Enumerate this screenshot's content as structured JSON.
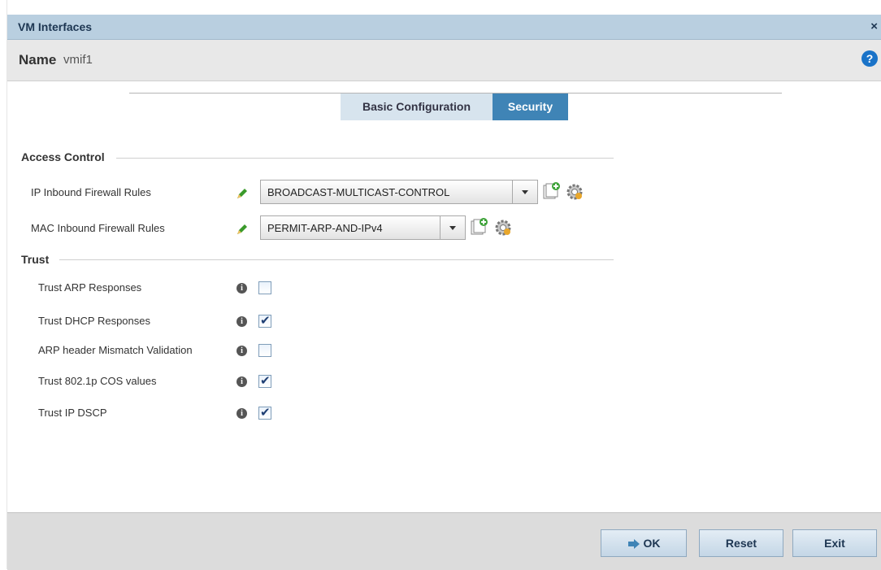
{
  "window": {
    "title": "VM Interfaces",
    "close_glyph": "×"
  },
  "name_bar": {
    "label": "Name",
    "value": "vmif1",
    "help_glyph": "?"
  },
  "tabs": [
    {
      "label": "Basic Configuration",
      "active": false
    },
    {
      "label": "Security",
      "active": true
    }
  ],
  "access_control": {
    "heading": "Access Control",
    "rows": [
      {
        "label": "IP Inbound Firewall Rules",
        "value": "BROADCAST-MULTICAST-CONTROL"
      },
      {
        "label": "MAC Inbound Firewall Rules",
        "value": "PERMIT-ARP-AND-IPv4"
      }
    ]
  },
  "trust": {
    "heading": "Trust",
    "items": [
      {
        "label": "Trust ARP Responses",
        "checked": false
      },
      {
        "label": "Trust DHCP Responses",
        "checked": true
      },
      {
        "label": "ARP header Mismatch Validation",
        "checked": false
      },
      {
        "label": "Trust 802.1p COS values",
        "checked": true
      },
      {
        "label": "Trust IP DSCP",
        "checked": true
      }
    ]
  },
  "footer": {
    "ok_label": "OK",
    "reset_label": "Reset",
    "exit_label": "Exit"
  },
  "colors": {
    "title_bar": "#b9cfe0",
    "active_tab": "#3f84b6",
    "inactive_tab": "#d7e4ee",
    "help_icon": "#1a73c8"
  }
}
